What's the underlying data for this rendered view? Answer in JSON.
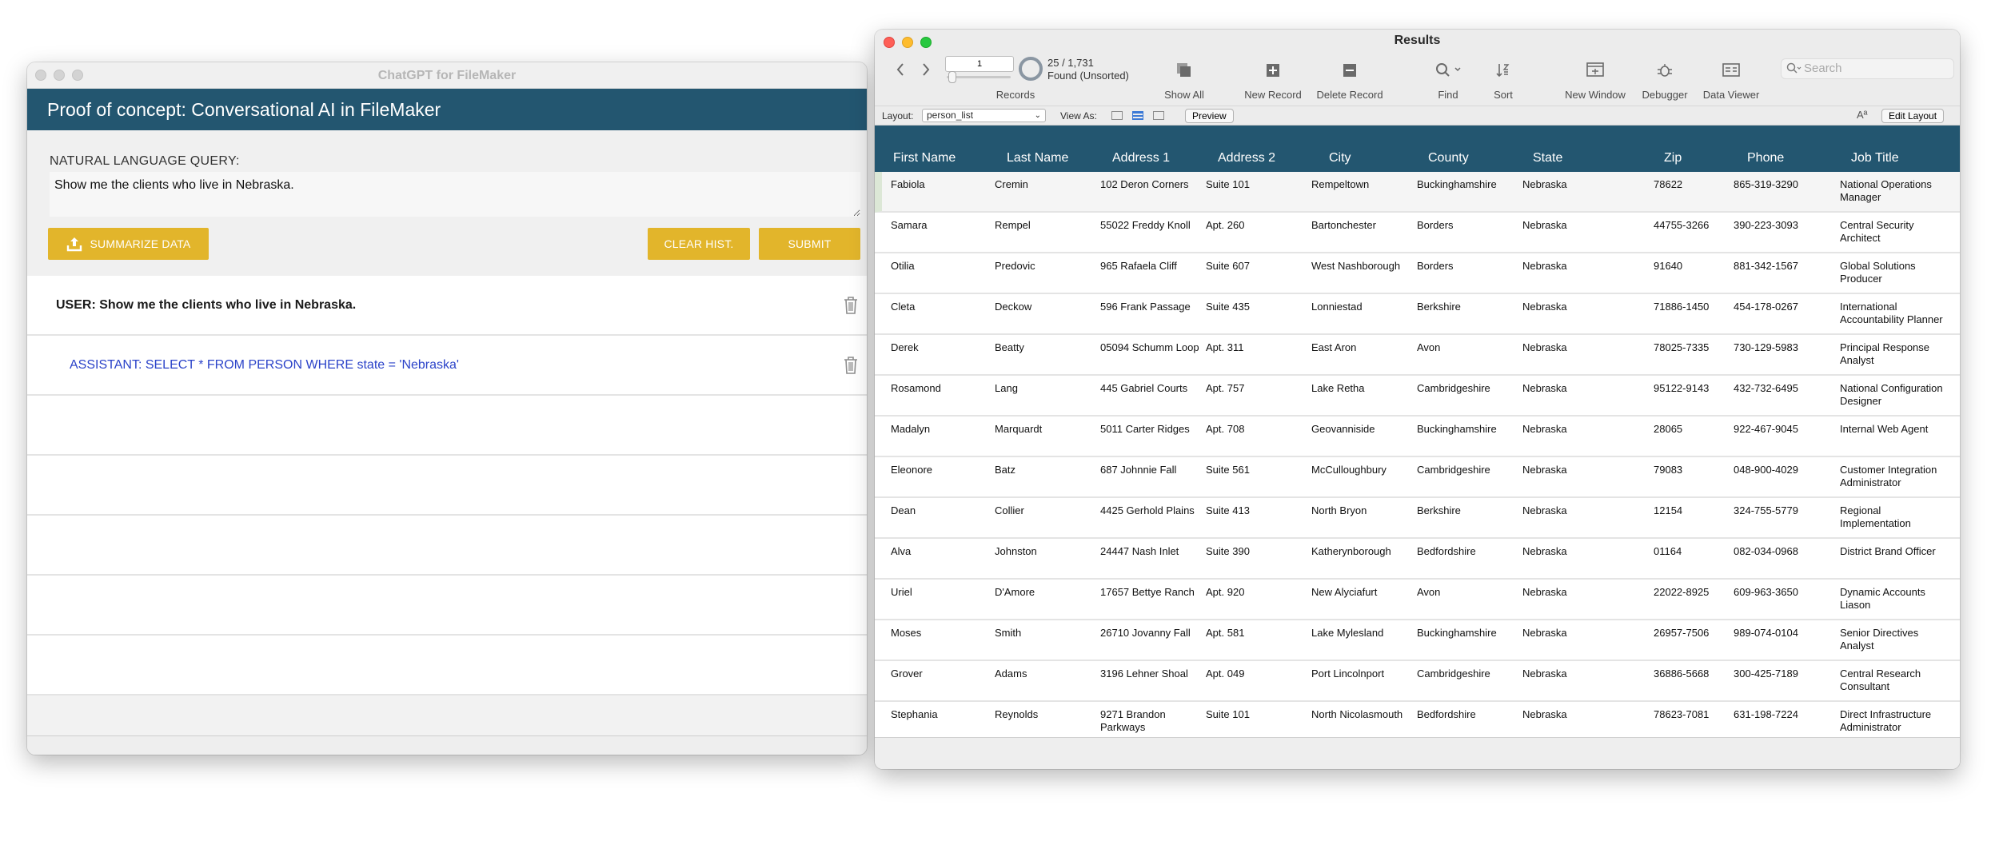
{
  "left_window": {
    "title": "ChatGPT for FileMaker",
    "banner": "Proof of concept: Conversational AI in FileMaker",
    "query_label": "NATURAL LANGUAGE QUERY:",
    "query_value": "Show me the clients who live in Nebraska.",
    "buttons": {
      "summarize": "SUMMARIZE DATA",
      "clear": "CLEAR HIST.",
      "submit": "SUBMIT"
    },
    "history": [
      {
        "role": "user",
        "text": "USER: Show me the clients who live in Nebraska."
      },
      {
        "role": "assistant",
        "text": "ASSISTANT: SELECT * FROM PERSON WHERE state = 'Nebraska'"
      }
    ],
    "accent_color": "#e2b52b",
    "banner_color": "#235670",
    "assistant_color": "#2b43c9"
  },
  "right_window": {
    "title": "Results",
    "record_field": "1",
    "record_count": "25 / 1,731",
    "found_status": "Found (Unsorted)",
    "toolbar": {
      "records": "Records",
      "show_all": "Show All",
      "new_record": "New Record",
      "delete_record": "Delete Record",
      "find": "Find",
      "sort": "Sort",
      "new_window": "New Window",
      "debugger": "Debugger",
      "data_viewer": "Data Viewer",
      "search_placeholder": "Search"
    },
    "layoutbar": {
      "layout_label": "Layout:",
      "layout_value": "person_list",
      "view_as": "View As:",
      "preview": "Preview",
      "edit_layout": "Edit Layout",
      "font_icon": "Aª"
    },
    "columns": [
      "First Name",
      "Last Name",
      "Address 1",
      "Address 2",
      "City",
      "County",
      "State",
      "Zip",
      "Phone",
      "Job Title"
    ],
    "rows": [
      [
        "Fabiola",
        "Cremin",
        "102 Deron Corners",
        "Suite 101",
        "Rempeltown",
        "Buckinghamshire",
        "Nebraska",
        "78622",
        "865-319-3290",
        "National Operations Manager"
      ],
      [
        "Samara",
        "Rempel",
        "55022 Freddy Knoll",
        "Apt. 260",
        "Bartonchester",
        "Borders",
        "Nebraska",
        "44755-3266",
        "390-223-3093",
        "Central Security Architect"
      ],
      [
        "Otilia",
        "Predovic",
        "965 Rafaela Cliff",
        "Suite 607",
        "West Nashborough",
        "Borders",
        "Nebraska",
        "91640",
        "881-342-1567",
        "Global Solutions Producer"
      ],
      [
        "Cleta",
        "Deckow",
        "596 Frank Passage",
        "Suite 435",
        "Lonniestad",
        "Berkshire",
        "Nebraska",
        "71886-1450",
        "454-178-0267",
        "International Accountability Planner"
      ],
      [
        "Derek",
        "Beatty",
        "05094 Schumm Loop",
        "Apt. 311",
        "East Aron",
        "Avon",
        "Nebraska",
        "78025-7335",
        "730-129-5983",
        "Principal Response Analyst"
      ],
      [
        "Rosamond",
        "Lang",
        "445 Gabriel Courts",
        "Apt. 757",
        "Lake Retha",
        "Cambridgeshire",
        "Nebraska",
        "95122-9143",
        "432-732-6495",
        "National Configuration Designer"
      ],
      [
        "Madalyn",
        "Marquardt",
        "5011 Carter Ridges",
        "Apt. 708",
        "Geovanniside",
        "Buckinghamshire",
        "Nebraska",
        "28065",
        "922-467-9045",
        "Internal Web Agent"
      ],
      [
        "Eleonore",
        "Batz",
        "687 Johnnie Fall",
        "Suite 561",
        "McCulloughbury",
        "Cambridgeshire",
        "Nebraska",
        "79083",
        "048-900-4029",
        "Customer Integration Administrator"
      ],
      [
        "Dean",
        "Collier",
        "4425 Gerhold Plains",
        "Suite 413",
        "North Bryon",
        "Berkshire",
        "Nebraska",
        "12154",
        "324-755-5779",
        "Regional Implementation"
      ],
      [
        "Alva",
        "Johnston",
        "24447 Nash Inlet",
        "Suite 390",
        "Katherynborough",
        "Bedfordshire",
        "Nebraska",
        "01164",
        "082-034-0968",
        "District Brand Officer"
      ],
      [
        "Uriel",
        "D'Amore",
        "17657 Bettye Ranch",
        "Apt. 920",
        "New Alyciafurt",
        "Avon",
        "Nebraska",
        "22022-8925",
        "609-963-3650",
        "Dynamic Accounts Liason"
      ],
      [
        "Moses",
        "Smith",
        "26710 Jovanny Fall",
        "Apt. 581",
        "Lake Mylesland",
        "Buckinghamshire",
        "Nebraska",
        "26957-7506",
        "989-074-0104",
        "Senior Directives Analyst"
      ],
      [
        "Grover",
        "Adams",
        "3196 Lehner Shoal",
        "Apt. 049",
        "Port Lincolnport",
        "Cambridgeshire",
        "Nebraska",
        "36886-5668",
        "300-425-7189",
        "Central Research Consultant"
      ],
      [
        "Stephania",
        "Reynolds",
        "9271 Brandon Parkways",
        "Suite 101",
        "North Nicolasmouth",
        "Bedfordshire",
        "Nebraska",
        "78623-7081",
        "631-198-7224",
        "Direct Infrastructure Administrator"
      ]
    ],
    "header_color": "#235670"
  }
}
